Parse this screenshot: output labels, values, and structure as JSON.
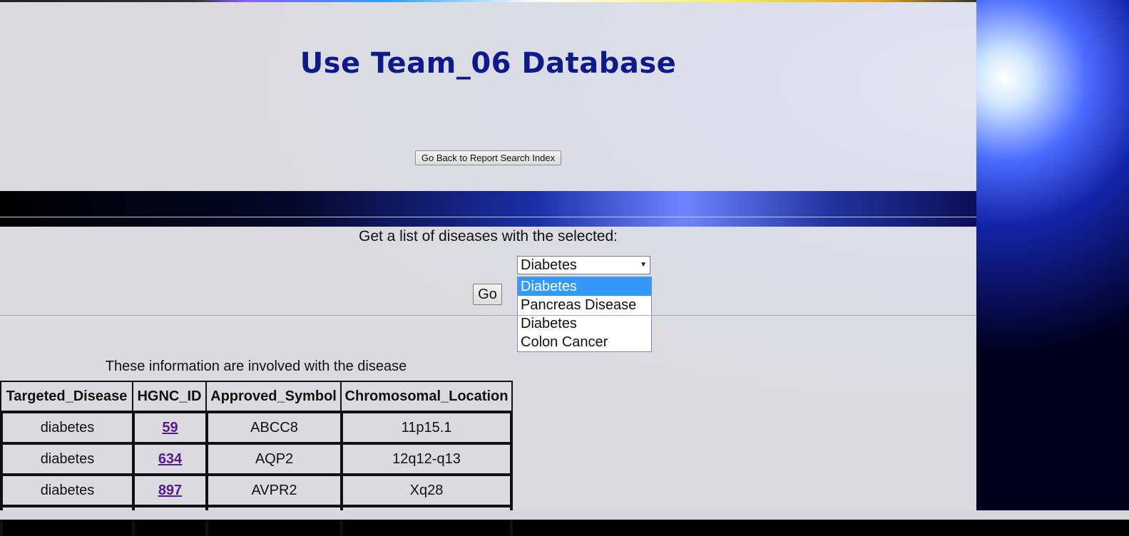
{
  "header": {
    "title": "Use Team_06 Database",
    "back_button_label": "Go Back to Report Search Index"
  },
  "search": {
    "prompt": "Get a list of diseases with the selected:",
    "selected_value": "Diabetes",
    "options": [
      "Diabetes",
      "Pancreas Disease",
      "Diabetes",
      "Colon Cancer"
    ],
    "go_label": "Go"
  },
  "results": {
    "caption": "These information are involved with the disease",
    "columns": [
      "Targeted_Disease",
      "HGNC_ID",
      "Approved_Symbol",
      "Chromosomal_Location"
    ],
    "rows": [
      {
        "disease": "diabetes",
        "hgnc_id": "59",
        "symbol": "ABCC8",
        "location": "11p15.1"
      },
      {
        "disease": "diabetes",
        "hgnc_id": "634",
        "symbol": "AQP2",
        "location": "12q12-q13"
      },
      {
        "disease": "diabetes",
        "hgnc_id": "897",
        "symbol": "AVPR2",
        "location": "Xq28"
      }
    ]
  },
  "colors": {
    "title": "#0d1a8a",
    "link": "#551a8b",
    "dropdown_highlight": "#3399ff"
  }
}
